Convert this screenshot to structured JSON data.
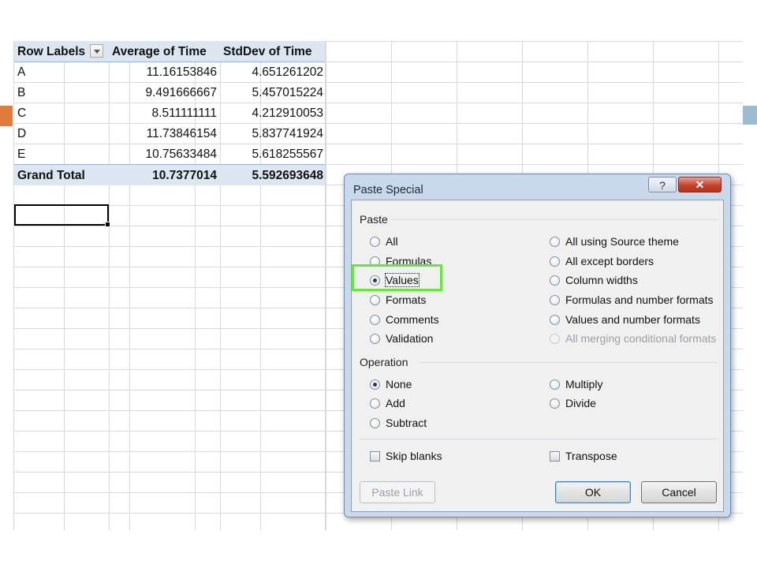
{
  "pivot": {
    "headers": [
      "Row Labels",
      "Average of Time",
      "StdDev of Time"
    ],
    "rows": [
      {
        "label": "A",
        "avg": "11.16153846",
        "std": "4.651261202"
      },
      {
        "label": "B",
        "avg": "9.491666667",
        "std": "5.457015224"
      },
      {
        "label": "C",
        "avg": "8.511111111",
        "std": "4.212910053"
      },
      {
        "label": "D",
        "avg": "11.73846154",
        "std": "5.837741924"
      },
      {
        "label": "E",
        "avg": "10.75633484",
        "std": "5.618255567"
      }
    ],
    "total": {
      "label": "Grand Total",
      "avg": "10.7377014",
      "std": "5.592693648"
    }
  },
  "dialog": {
    "title": "Paste Special",
    "help_label": "?",
    "close_label": "✕",
    "paste_group": "Paste",
    "paste_options_left": [
      "All",
      "Formulas",
      "Values",
      "Formats",
      "Comments",
      "Validation"
    ],
    "paste_options_right": [
      "All using Source theme",
      "All except borders",
      "Column widths",
      "Formulas and number formats",
      "Values and number formats",
      "All merging conditional formats"
    ],
    "paste_selected": "Values",
    "operation_group": "Operation",
    "operation_left": [
      "None",
      "Add",
      "Subtract"
    ],
    "operation_right": [
      "Multiply",
      "Divide"
    ],
    "operation_selected": "None",
    "skip_blanks": "Skip blanks",
    "transpose": "Transpose",
    "paste_link": "Paste Link",
    "ok": "OK",
    "cancel": "Cancel"
  },
  "colors": {
    "accent_left": "#e07b39",
    "accent_right": "#9bbad4",
    "highlight": "#66e83a",
    "pivot_header": "#dce6f1"
  },
  "icons": {
    "filter": "dropdown-arrow-icon",
    "help": "help-icon",
    "close": "close-icon"
  }
}
